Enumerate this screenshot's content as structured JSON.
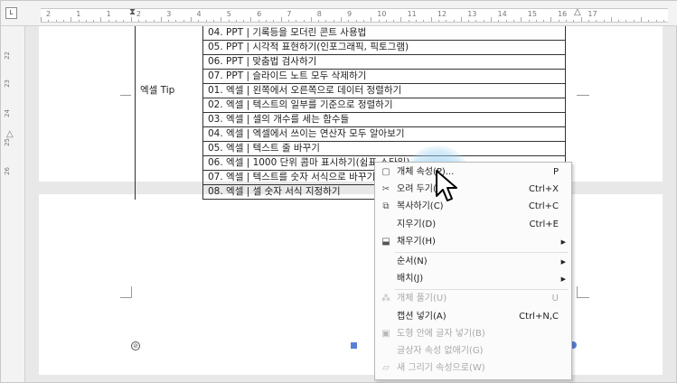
{
  "ruler": {
    "corner": "L",
    "numbers": [
      "2",
      "1",
      "1",
      "2",
      "3",
      "4",
      "5",
      "6",
      "7",
      "8",
      "9",
      "10",
      "11",
      "12",
      "13",
      "14",
      "15",
      "16",
      "17"
    ],
    "vertical_numbers": [
      "22",
      "23",
      "24",
      "25",
      "26"
    ]
  },
  "table": {
    "rows": [
      {
        "category": "",
        "item": "04. PPT | 기록등을 모더린 콘트 사용법"
      },
      {
        "category": "",
        "item": "05. PPT | 시각적 표현하기(인포그래픽, 픽토그램)"
      },
      {
        "category": "",
        "item": "06. PPT | 맞춤법 검사하기"
      },
      {
        "category": "",
        "item": "07. PPT | 슬라이드 노트 모두 삭제하기"
      },
      {
        "category": "엑셀 Tip",
        "item": "01. 엑셀 | 왼쪽에서 오른쪽으로 데이터 정렬하기"
      },
      {
        "category": "",
        "item": "02. 엑셀 | 텍스트의 일부를 기준으로 정렬하기"
      },
      {
        "category": "",
        "item": "03. 엑셀 | 셀의 개수를 세는 함수들"
      },
      {
        "category": "",
        "item": "04. 엑셀 | 엑셀에서 쓰이는 연산자 모두 알아보기"
      },
      {
        "category": "",
        "item": "05. 엑셀 | 텍스트 줄 바꾸기"
      },
      {
        "category": "",
        "item": "06. 엑셀 | 1000 단위 콤마 표시하기(쉼표 스타일)"
      },
      {
        "category": "",
        "item": "07. 엑셀 | 텍스트를 숫자 서식으로 바꾸기"
      },
      {
        "category": "",
        "item": "08. 엑셀 | 셀 숫자 서식 지정하기"
      }
    ]
  },
  "context_menu": {
    "items": [
      {
        "icon": "object-properties-icon",
        "glyph": "▢",
        "label": "개체 속성(P)...",
        "shortcut": "P",
        "disabled": false,
        "submenu": false
      },
      {
        "icon": "scissors-icon",
        "glyph": "✂",
        "label": "오려 두기(T)",
        "shortcut": "Ctrl+X",
        "disabled": false,
        "submenu": false
      },
      {
        "icon": "copy-icon",
        "glyph": "⧉",
        "label": "복사하기(C)",
        "shortcut": "Ctrl+C",
        "disabled": false,
        "submenu": false
      },
      {
        "icon": "",
        "glyph": "",
        "label": "지우기(D)",
        "shortcut": "Ctrl+E",
        "disabled": false,
        "submenu": false
      },
      {
        "icon": "fill-icon",
        "glyph": "⬓",
        "label": "채우기(H)",
        "shortcut": "",
        "disabled": false,
        "submenu": true
      },
      {
        "icon": "",
        "glyph": "",
        "label": "순서(N)",
        "shortcut": "",
        "disabled": false,
        "submenu": true
      },
      {
        "icon": "",
        "glyph": "",
        "label": "배치(J)",
        "shortcut": "",
        "disabled": false,
        "submenu": true
      },
      {
        "icon": "ungroup-icon",
        "glyph": "⁂",
        "label": "개체 풀기(U)",
        "shortcut": "U",
        "disabled": true,
        "submenu": false
      },
      {
        "icon": "",
        "glyph": "",
        "label": "캡션 넣기(A)",
        "shortcut": "Ctrl+N,C",
        "disabled": false,
        "submenu": false
      },
      {
        "icon": "text-in-shape-icon",
        "glyph": "▣",
        "label": "도형 안에 글자 넣기(B)",
        "shortcut": "",
        "disabled": true,
        "submenu": false
      },
      {
        "icon": "",
        "glyph": "",
        "label": "글상자 속성 없애기(G)",
        "shortcut": "",
        "disabled": true,
        "submenu": false
      },
      {
        "icon": "new-drawing-properties-icon",
        "glyph": "▱",
        "label": "새 그리기 속성으로(W)",
        "shortcut": "",
        "disabled": true,
        "submenu": false
      }
    ],
    "separators_after": [
      4,
      6
    ]
  },
  "colors": {
    "handle_blue": "#5a7fd6",
    "highlight": "#8cc8eb"
  }
}
